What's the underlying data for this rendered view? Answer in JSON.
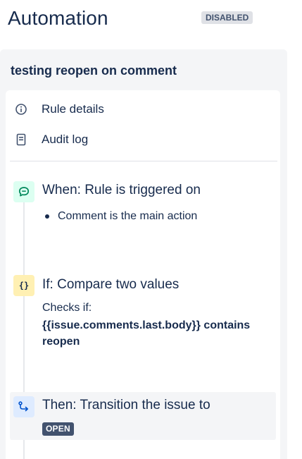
{
  "header": {
    "title": "Automation",
    "status": "DISABLED"
  },
  "rule": {
    "name": "testing reopen on comment"
  },
  "menu": {
    "rule_details": "Rule details",
    "audit_log": "Audit log"
  },
  "trigger": {
    "title": "When: Rule is triggered on",
    "items": [
      "Comment is the main action"
    ]
  },
  "condition": {
    "title": "If: Compare two values",
    "icon_glyph": "{}",
    "checks_label": "Checks if:",
    "expression": "{{issue.comments.last.body}} contains reopen"
  },
  "action": {
    "title": "Then: Transition the issue to",
    "status": "OPEN"
  },
  "colors": {
    "trigger_bg": "#dcfff1",
    "trigger_icon": "#00875a",
    "condition_bg": "#fff0b3",
    "action_bg": "#deebff",
    "action_icon": "#0052cc",
    "open_lozenge": "#42526e"
  },
  "icons": {
    "rule_details": "info-icon",
    "audit_log": "document-icon",
    "trigger": "comment-icon",
    "condition": "braces-icon",
    "action": "transition-icon"
  }
}
